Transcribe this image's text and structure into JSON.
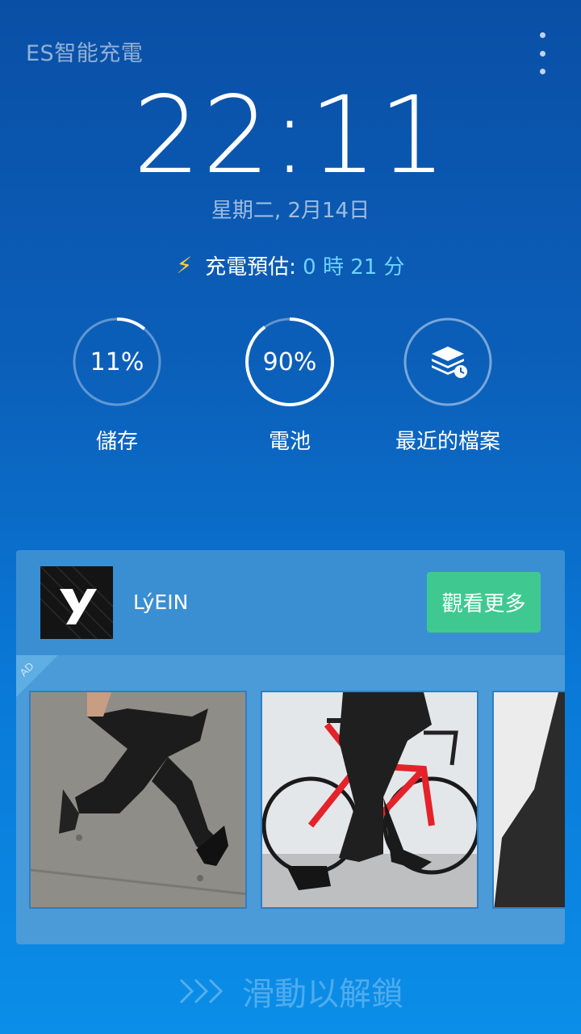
{
  "header": {
    "app_title": "ES智能充電",
    "menu_icon": "more-vert-icon"
  },
  "clock": {
    "time": "22:11",
    "date": "星期二, 2月14日"
  },
  "charging": {
    "icon": "lightning-bolt-icon",
    "label": "充電預估:",
    "value": "0 時  21 分"
  },
  "stats": [
    {
      "value": "11%",
      "label": "儲存",
      "progress": 0.11
    },
    {
      "value": "90%",
      "label": "電池",
      "progress": 0.9
    },
    {
      "value": "",
      "label": "最近的檔案",
      "icon": "layers-clock-icon"
    }
  ],
  "ad": {
    "logo_text": "y",
    "brand": "LýEIN",
    "cta": "觀看更多",
    "badge": "AD",
    "images": [
      "person-jumping-photo",
      "person-on-bicycle-photo",
      "partial-photo"
    ]
  },
  "unlock": {
    "icon": "chevrons-right-icon",
    "label": "滑動以解鎖"
  },
  "colors": {
    "accent_green": "#3fc990",
    "charge_value": "#6cd3ff",
    "bolt": "#ffd23a"
  }
}
